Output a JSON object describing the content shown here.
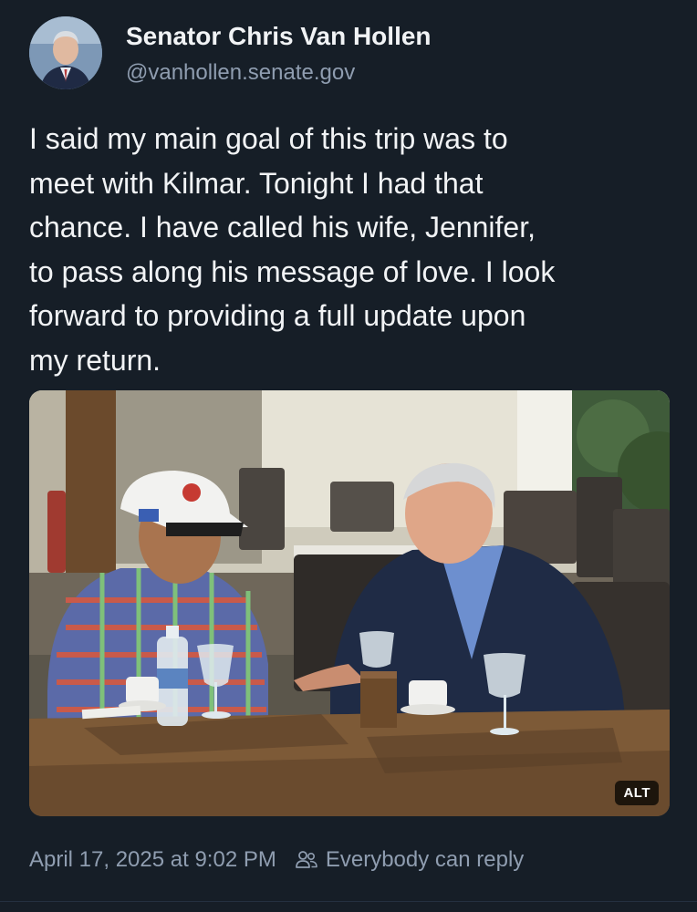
{
  "author": {
    "name": "Senator Chris Van Hollen",
    "handle": "@vanhollen.senate.gov"
  },
  "post": {
    "text_lines": [
      "I said my main goal of this trip was to",
      "meet with Kilmar. Tonight I had that",
      "chance. I have called his wife, Jennifer,",
      "to pass along his message of love. I look",
      "forward to providing a full update upon",
      "my return."
    ]
  },
  "media": {
    "alt_label": "ALT"
  },
  "footer": {
    "timestamp": "April 17, 2025 at 9:02 PM",
    "reply_setting": "Everybody can reply",
    "reply_icon": "people-icon"
  }
}
